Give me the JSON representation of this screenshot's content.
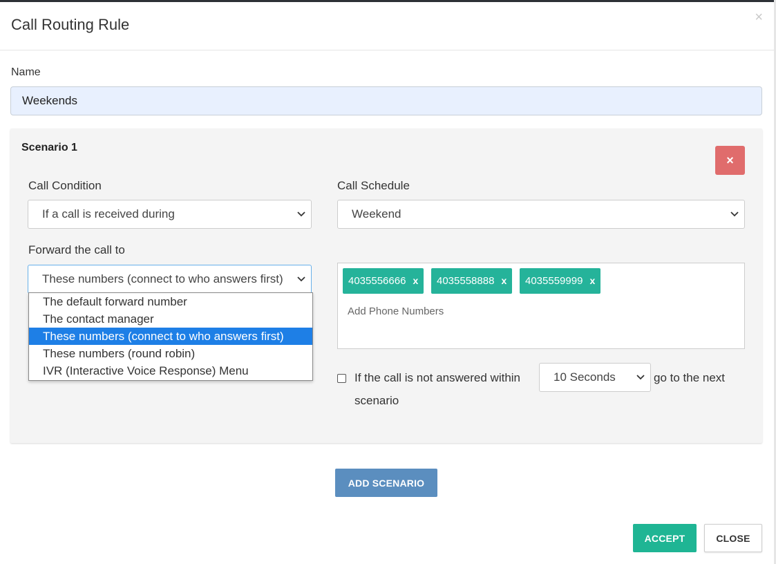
{
  "modal": {
    "title": "Call Routing Rule",
    "close_symbol": "×"
  },
  "name": {
    "label": "Name",
    "value": "Weekends"
  },
  "scenario": {
    "title": "Scenario 1",
    "remove_symbol": "×",
    "call_condition": {
      "label": "Call Condition",
      "value": "If a call is received during"
    },
    "call_schedule": {
      "label": "Call Schedule",
      "value": "Weekend"
    },
    "forward": {
      "label": "Forward the call to",
      "value": "These numbers (connect to who answers first)",
      "options": [
        "The default forward number",
        "The contact manager",
        "These numbers (connect to who answers first)",
        "These numbers (round robin)",
        "IVR (Interactive Voice Response) Menu"
      ],
      "selected_index": 2
    },
    "phones": {
      "tags": [
        "4035556666",
        "4035558888",
        "4035559999"
      ],
      "tag_remove": "x",
      "placeholder": "Add Phone Numbers"
    },
    "no_answer": {
      "text_before": "If the call is not answered within",
      "seconds_value": "10 Seconds",
      "text_after": "go to the next",
      "text_wrap": "scenario"
    }
  },
  "buttons": {
    "add_scenario": "ADD SCENARIO",
    "accept": "ACCEPT",
    "close": "CLOSE"
  },
  "colors": {
    "accent_teal": "#25b39a",
    "danger": "#e06c6c",
    "primary_blue": "#5b8ebf",
    "selection_blue": "#1e7fe6",
    "name_input_bg": "#e8f0fe"
  }
}
